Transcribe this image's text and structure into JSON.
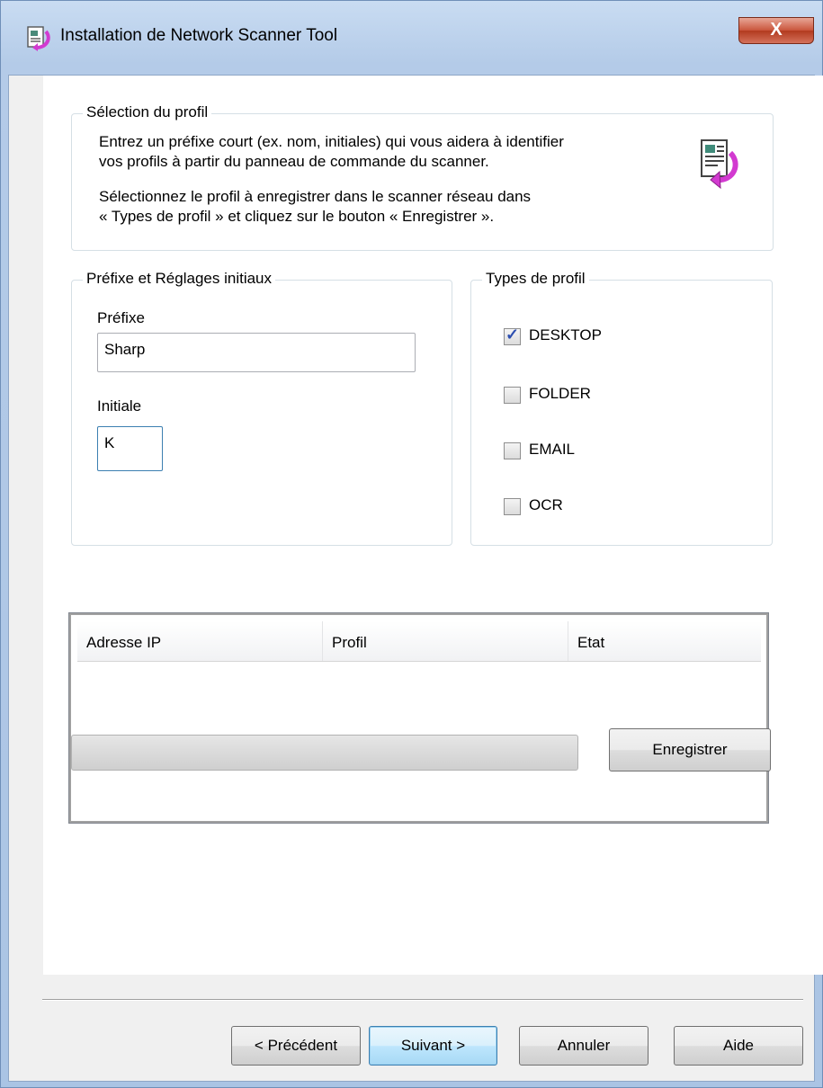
{
  "window": {
    "title": "Installation de Network Scanner Tool",
    "close_label": "X",
    "icon": "installer-icon"
  },
  "profile_selection": {
    "legend": "Sélection du profil",
    "line1": "Entrez un préfixe court (ex. nom, initiales) qui vous aidera à identifier",
    "line2": "vos profils à partir du panneau de commande du scanner.",
    "line3": "Sélectionnez le profil à enregistrer dans le scanner réseau dans",
    "line4": "« Types de profil » et cliquez sur le bouton « Enregistrer ».",
    "icon": "document-arrow-icon"
  },
  "prefix_settings": {
    "legend": "Préfixe et Réglages initiaux",
    "prefix_label": "Préfixe",
    "prefix_value": "Sharp",
    "initial_label": "Initiale",
    "initial_value": "K"
  },
  "profile_types": {
    "legend": "Types de profil",
    "items": [
      {
        "label": "DESKTOP",
        "checked": true
      },
      {
        "label": "FOLDER",
        "checked": false
      },
      {
        "label": "EMAIL",
        "checked": false
      },
      {
        "label": "OCR",
        "checked": false
      }
    ]
  },
  "table": {
    "columns": [
      "Adresse IP",
      "Profil",
      "Etat"
    ],
    "rows": []
  },
  "progress": {
    "value": 0
  },
  "buttons": {
    "register": "Enregistrer",
    "previous": "< Précédent",
    "next": "Suivant >",
    "cancel": "Annuler",
    "help": "Aide"
  },
  "colors": {
    "accent_focus": "#3c7fb1",
    "checkmark": "#2d4fb0",
    "icon_magenta": "#d23ad0"
  }
}
